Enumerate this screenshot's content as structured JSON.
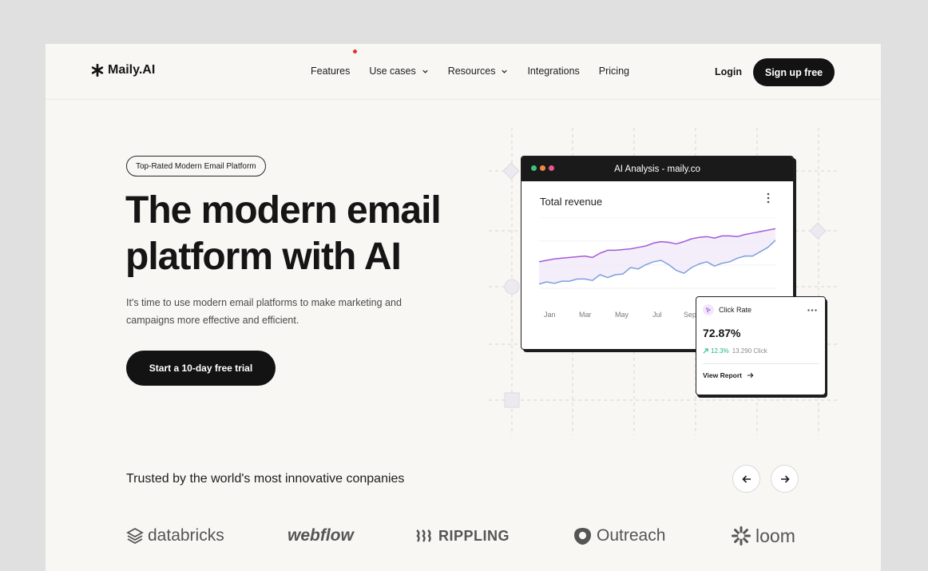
{
  "brand": {
    "name": "Maily.AI"
  },
  "nav": {
    "items": [
      {
        "label": "Features",
        "dropdown": false
      },
      {
        "label": "Use cases",
        "dropdown": true
      },
      {
        "label": "Resources",
        "dropdown": true
      },
      {
        "label": "Integrations",
        "dropdown": false
      },
      {
        "label": "Pricing",
        "dropdown": false
      }
    ],
    "login": "Login",
    "signup": "Sign up free"
  },
  "hero": {
    "badge": "Top-Rated Modern Email Platform",
    "headline": "The modern email platform with AI",
    "subtext": "It's time to use modern email platforms to make marketing and campaigns more effective and efficient.",
    "cta": "Start a 10-day free trial"
  },
  "dashboard": {
    "window_title": "AI Analysis - maily.co",
    "window_dot_colors": [
      "#3fbf7f",
      "#f0883e",
      "#e8568a"
    ],
    "chart_title": "Total revenue",
    "months": [
      "Jan",
      "Mar",
      "May",
      "Jul",
      "Sep"
    ]
  },
  "chart_data": {
    "type": "area",
    "title": "Total revenue",
    "x": [
      "Jan",
      "Mar",
      "May",
      "Jul",
      "Sep"
    ],
    "series": [
      {
        "color": "#a35ad8",
        "values": [
          0.62,
          0.6,
          0.58,
          0.57,
          0.56,
          0.55,
          0.54,
          0.56,
          0.5,
          0.46,
          0.46,
          0.45,
          0.44,
          0.42,
          0.4,
          0.36,
          0.34,
          0.35,
          0.37,
          0.34,
          0.3,
          0.28,
          0.27,
          0.29,
          0.26,
          0.26,
          0.27,
          0.24,
          0.22,
          0.2,
          0.18,
          0.16
        ]
      },
      {
        "color": "#7d9fe0",
        "values": [
          0.93,
          0.9,
          0.92,
          0.89,
          0.89,
          0.86,
          0.86,
          0.88,
          0.8,
          0.84,
          0.8,
          0.79,
          0.7,
          0.72,
          0.66,
          0.62,
          0.6,
          0.66,
          0.74,
          0.78,
          0.7,
          0.65,
          0.62,
          0.68,
          0.64,
          0.62,
          0.57,
          0.54,
          0.54,
          0.48,
          0.42,
          0.32
        ]
      }
    ]
  },
  "click_rate": {
    "label": "Click Rate",
    "value": "72.87%",
    "change": "12.3%",
    "clicks": "13.290 Click",
    "link": "View Report"
  },
  "trusted": {
    "heading": "Trusted by the world's most innovative conpanies",
    "logos": [
      "databricks",
      "webflow",
      "RIPPLING",
      "Outreach",
      "loom"
    ]
  },
  "colors": {
    "accent": "#141313",
    "background": "#f8f7f4",
    "positive": "#1fb48c"
  }
}
